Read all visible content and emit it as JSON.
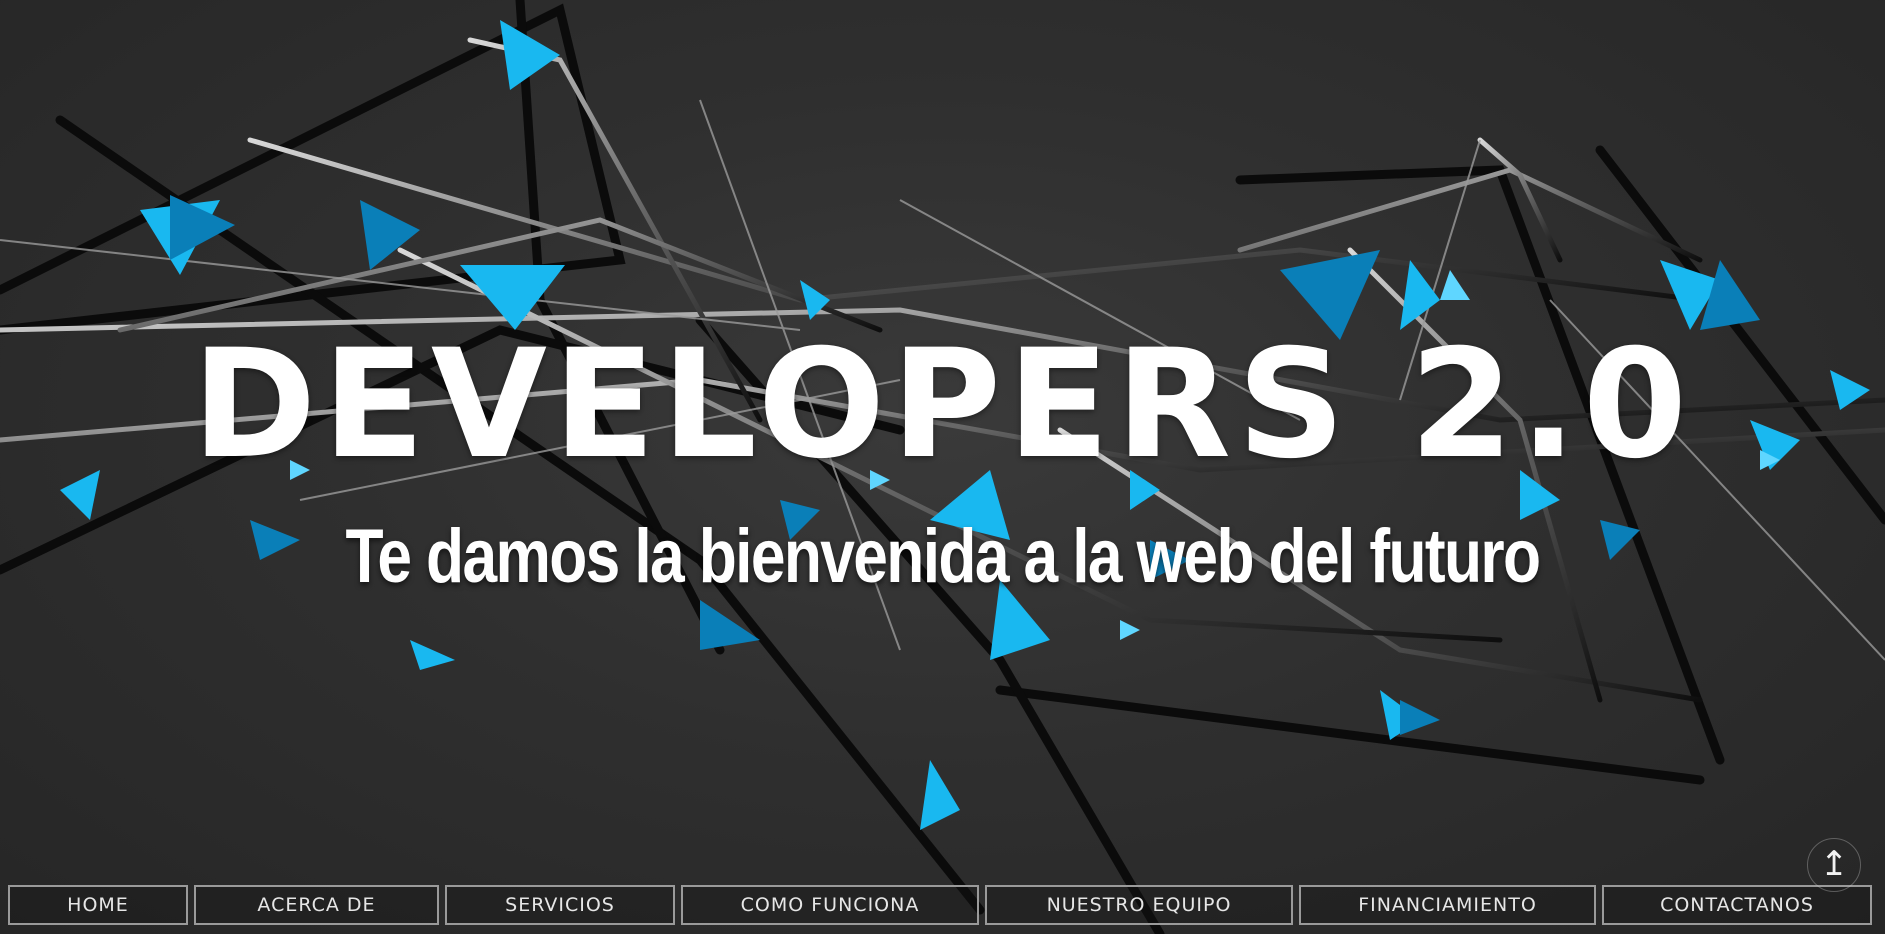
{
  "hero": {
    "title": "DEVELOPERS 2.0",
    "subtitle": "Te damos la bienvenida a la web del futuro",
    "accent_color": "#19b8f0",
    "background_color": "#2f2f2f"
  },
  "nav": {
    "items": [
      {
        "label": "HOME"
      },
      {
        "label": "ACERCA DE"
      },
      {
        "label": "SERVICIOS"
      },
      {
        "label": "COMO FUNCIONA"
      },
      {
        "label": "NUESTRO EQUIPO"
      },
      {
        "label": "FINANCIAMIENTO"
      },
      {
        "label": "CONTACTANOS"
      }
    ]
  },
  "scroll_top": {
    "icon": "arrow-up-icon",
    "glyph": "↥"
  }
}
